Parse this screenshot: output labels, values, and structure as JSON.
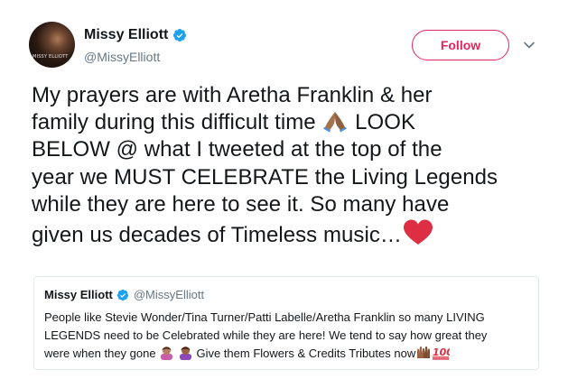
{
  "author": {
    "name": "Missy Elliott",
    "handle": "@MissyElliott",
    "avatar_text": "MISSY ELLIOTT"
  },
  "follow_button": {
    "label": "Follow"
  },
  "tweet": {
    "lines": [
      "My prayers are with Aretha Franklin & her",
      "family during this difficult time",
      "LOOK",
      "BELOW @ what I tweeted at the top of the",
      "year we MUST CELEBRATE the Living Legends",
      "while they are here to see it. So many have",
      "given us decades of Timeless music…"
    ],
    "emojis": [
      "folded-hands",
      "red-heart"
    ]
  },
  "quoted_tweet": {
    "name": "Missy Elliott",
    "handle": "@MissyElliott",
    "lines": [
      "People like Stevie Wonder/Tina Turner/Patti Labelle/Aretha Franklin so many LIVING",
      "LEGENDS need to be Celebrated while they are here! We tend to say how great they",
      "were when they gone",
      "Give them Flowers & Credits Tributes now"
    ],
    "emojis": [
      "person-tipping-hand",
      "person-tipping-hand",
      "raising-hands",
      "hundred-points"
    ]
  },
  "colors": {
    "text": "#14171a",
    "secondary": "#657786",
    "accent": "#e0245e",
    "verified": "#1da1f2",
    "border": "#e1e8ed"
  }
}
